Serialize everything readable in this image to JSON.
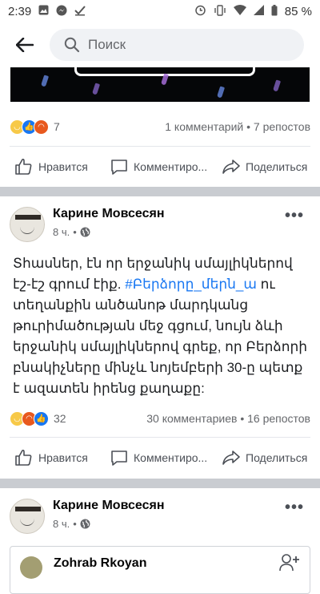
{
  "status_bar": {
    "time": "2:39",
    "battery": "85 %"
  },
  "search": {
    "placeholder": "Поиск"
  },
  "post1": {
    "reaction_count": "7",
    "comments": "1 комментарий",
    "shares": "7 репостов"
  },
  "post2": {
    "author": "Карине Мовсесян",
    "time": "8 ч.",
    "text_before": "Տհասներ, էն որ երջանիկ սմայլիկներով էշ-էշ գրում էիք. ",
    "hashtag": "#Բերձորը_մերն_ա",
    "text_after": "  ու տեղանքին անծանոթ մարդկանց թուրիմածության մեջ գցում, նույն ձևի երջանիկ սմայլիկներով գրեք, որ Բերձորի բնակիչները մինչև նոյեմբերի 30-ը պետք է ազատեն իրենց քաղաքը:",
    "reaction_count": "32",
    "comments": "30 комментариев",
    "shares": "16 репостов"
  },
  "post3": {
    "author": "Карине Мовсесян",
    "time": "8 ч.",
    "shared_name": "Zohrab Rkoyan"
  },
  "actions": {
    "like": "Нравится",
    "comment": "Комментиро...",
    "share": "Поделиться"
  },
  "colors": {
    "accent": "#1877f2",
    "separator": "#c9ccd1",
    "angry": "#e8591e",
    "sad": "#f7c948"
  }
}
